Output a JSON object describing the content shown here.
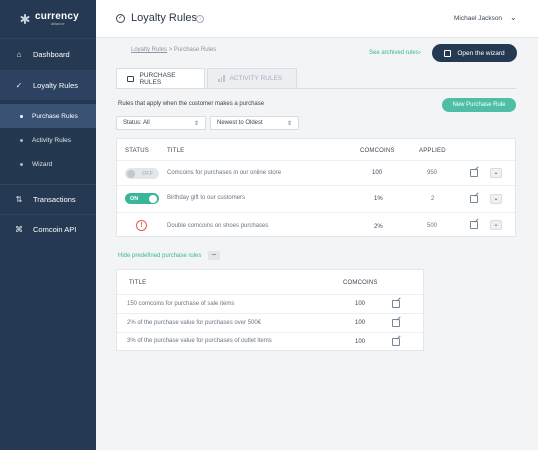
{
  "sidebar": {
    "logo": {
      "name": "currency",
      "sub": "alliance"
    },
    "items": [
      {
        "label": "Dashboard",
        "icon": "home-icon"
      },
      {
        "label": "Loyalty Rules",
        "icon": "check-circle-icon"
      },
      {
        "label": "Transactions",
        "icon": "arrows-icon"
      },
      {
        "label": "Comcoin API",
        "icon": "command-icon"
      }
    ],
    "sub_items": [
      {
        "label": "Purchase Rules"
      },
      {
        "label": "Activity Rules"
      },
      {
        "label": "Wizard"
      }
    ]
  },
  "header": {
    "title": "Loyalty Rules",
    "info": "i",
    "user": "Michael Jackson"
  },
  "breadcrumb": {
    "link": "Loyalty Rules",
    "sep": " > ",
    "current": "Purchase Rules"
  },
  "archived_link": "See archived rules›",
  "wizard_button": "Open the wizard",
  "tabs": [
    {
      "label": "PURCHASE RULES"
    },
    {
      "label": "ACTIVITY RULES"
    }
  ],
  "rules_label": "Rules that apply when the customer makes a purchase",
  "new_rule_button": "New Purchase Rule",
  "filters": {
    "status": "Status: All",
    "sort": "Newest to Oldest"
  },
  "rules_table": {
    "headers": {
      "status": "STATUS",
      "title": "TITLE",
      "comcoins": "COMCOINS",
      "applied": "APPLIED"
    },
    "rows": [
      {
        "status": "OFF",
        "title": "Comcoins for purchases in our online store",
        "comcoins": "100",
        "applied": "950"
      },
      {
        "status": "ON",
        "title": "Birthday gift to our customers",
        "comcoins": "1%",
        "applied": "2"
      },
      {
        "status": "!",
        "title": "Double comcoins on shoes purchases",
        "comcoins": "2%",
        "applied": "500"
      }
    ]
  },
  "hide_predefined": "Hide predefined purchase rules",
  "minus": "–",
  "predefined_table": {
    "headers": {
      "title": "TITLE",
      "comcoins": "COMCOINS"
    },
    "rows": [
      {
        "title": "150 comcoins for purchase of sale items",
        "comcoins": "100"
      },
      {
        "title": "2% of the purchase value for purchases over 500€",
        "comcoins": "100"
      },
      {
        "title": "3% of the purchase value for purchases of outlet items",
        "comcoins": "100"
      }
    ]
  },
  "colors": {
    "sidebar": "#253a52",
    "accent": "#3ab59a",
    "warning": "#e0604f"
  }
}
